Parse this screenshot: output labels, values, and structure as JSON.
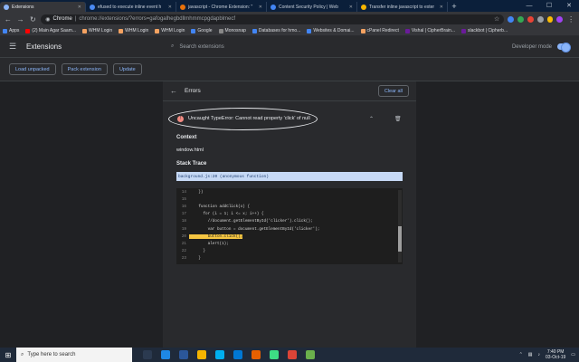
{
  "browser": {
    "tabs": [
      {
        "label": "Extensions",
        "active": true,
        "color": "#8ab4f8"
      },
      {
        "label": "efused to execute inline event h",
        "active": false,
        "color": "#4a8af4"
      },
      {
        "label": "javascript - Chrome Extension: \"",
        "active": false,
        "color": "#e8710a"
      },
      {
        "label": "Content Security Policy | Web",
        "active": false,
        "color": "#4285f4"
      },
      {
        "label": "Transfer inline javascript to exter",
        "active": false,
        "color": "#f4b400"
      }
    ],
    "new_tab": "+",
    "window_controls": [
      "—",
      "☐",
      "✕"
    ],
    "url_scheme": "Chrome",
    "url_separator": "|",
    "url": "chrome://extensions/?errors=gafogalhegbdllmhmmcpgdapblmecf",
    "bookmarks": [
      {
        "label": "Apps",
        "color": "#4285f4"
      },
      {
        "label": "(2) Main Agar Saam...",
        "color": "#ff0000"
      },
      {
        "label": "WHM Login",
        "color": "#f4a261"
      },
      {
        "label": "WHM Login",
        "color": "#f4a261"
      },
      {
        "label": "WHM Login",
        "color": "#f4a261"
      },
      {
        "label": "Google",
        "color": "#4285f4"
      },
      {
        "label": "Monosnap",
        "color": "#888888"
      },
      {
        "label": "Databases for hmo...",
        "color": "#4285f4"
      },
      {
        "label": "Websites & Domai...",
        "color": "#4285f4"
      },
      {
        "label": "cPanel Redirect",
        "color": "#f4a261"
      },
      {
        "label": "Vishal | CipherBrain...",
        "color": "#6a1b9a"
      },
      {
        "label": "slackbot | Cipherb...",
        "color": "#6a1b9a"
      }
    ]
  },
  "extensions_page": {
    "title": "Extensions",
    "search_placeholder": "Search extensions",
    "developer_mode_label": "Developer mode",
    "developer_mode_on": true,
    "buttons": {
      "load_unpacked": "Load unpacked",
      "pack_extension": "Pack extension",
      "update": "Update"
    }
  },
  "errors_view": {
    "title": "Errors",
    "clear_all": "Clear all",
    "error_message": "Uncaught TypeError: Cannot read property 'click' of null",
    "context_heading": "Context",
    "context_value": "window.html",
    "stack_trace_heading": "Stack Trace",
    "stack_frame": "background.js:20 (anonymous function)",
    "code_lines": [
      {
        "num": "14",
        "text": "    })",
        "highlight": false
      },
      {
        "num": "15",
        "text": "",
        "highlight": false
      },
      {
        "num": "16",
        "text": "    function addClick(x) {",
        "highlight": false
      },
      {
        "num": "17",
        "text": "      for (i = 1; i <= x; i++) {",
        "highlight": false
      },
      {
        "num": "18",
        "text": "        //document.getElementById('clicker').click();",
        "highlight": false
      },
      {
        "num": "19",
        "text": "        var button = document.getElementById('clicker');",
        "highlight": false
      },
      {
        "num": "20",
        "text": "        button.click();",
        "highlight": true
      },
      {
        "num": "21",
        "text": "        alert(1);",
        "highlight": false
      },
      {
        "num": "22",
        "text": "      }",
        "highlight": false
      },
      {
        "num": "23",
        "text": "    }",
        "highlight": false
      }
    ]
  },
  "taskbar": {
    "search_placeholder": "Type here to search",
    "time": "7:40 PM",
    "date": "03-Oct-19",
    "apps": [
      {
        "name": "task-view",
        "color": "#2b3a50"
      },
      {
        "name": "edge",
        "color": "#1e88e5"
      },
      {
        "name": "word",
        "color": "#2b579a"
      },
      {
        "name": "file-explorer",
        "color": "#f4b400"
      },
      {
        "name": "skype",
        "color": "#00aff0"
      },
      {
        "name": "photos",
        "color": "#0078d4"
      },
      {
        "name": "firefox",
        "color": "#e66000"
      },
      {
        "name": "android-studio",
        "color": "#3ddc84"
      },
      {
        "name": "chrome",
        "color": "#db4437"
      },
      {
        "name": "notepad",
        "color": "#6ab04c"
      }
    ]
  }
}
